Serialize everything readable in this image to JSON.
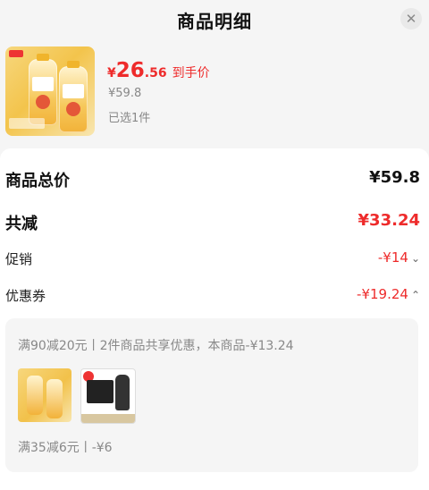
{
  "header": {
    "title": "商品明细",
    "close_icon": "close-icon"
  },
  "product": {
    "price_yen": "¥",
    "price_int": "26",
    "price_dec": ".56",
    "price_label": "到手价",
    "original_price": "¥59.8",
    "selected": "已选1件"
  },
  "summary": {
    "total_label": "商品总价",
    "total_value": "¥59.8",
    "reduce_label": "共减",
    "reduce_value": "¥33.24",
    "promo_label": "促销",
    "promo_value": "-¥14",
    "coupon_label": "优惠券",
    "coupon_value": "-¥19.24"
  },
  "coupon_detail": {
    "line1": "满90减20元丨2件商品共享优惠，本商品-¥13.24",
    "line2": "满35减6元丨-¥6"
  },
  "colors": {
    "accent_red": "#ee2b2b",
    "panel_bg": "#f5f5f5"
  }
}
